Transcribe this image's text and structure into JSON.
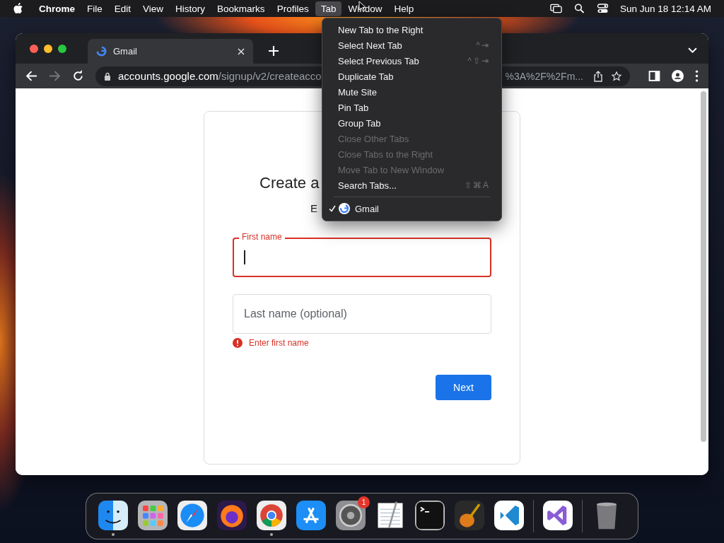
{
  "menu_bar": {
    "items": [
      {
        "label": "Chrome",
        "selected": false
      },
      {
        "label": "File",
        "selected": false
      },
      {
        "label": "Edit",
        "selected": false
      },
      {
        "label": "View",
        "selected": false
      },
      {
        "label": "History",
        "selected": false
      },
      {
        "label": "Bookmarks",
        "selected": false
      },
      {
        "label": "Profiles",
        "selected": false
      },
      {
        "label": "Tab",
        "selected": true
      },
      {
        "label": "Window",
        "selected": false
      },
      {
        "label": "Help",
        "selected": false
      }
    ],
    "clock": "Sun Jun 18  12:14 AM"
  },
  "browser": {
    "tabs": [
      {
        "title": "Gmail",
        "selected": true
      }
    ],
    "address": {
      "host": "accounts.google.com",
      "path": "/signup/v2/createacco",
      "tail": "%3A%2F%2Fm..."
    }
  },
  "page": {
    "title": "Create a",
    "subtitle": "E",
    "fields": [
      {
        "label": "First name",
        "focused": true,
        "error": true
      },
      {
        "placeholder": "Last name (optional)",
        "focused": false,
        "error": false
      }
    ],
    "error_message": "Enter first name",
    "next_button": "Next"
  },
  "tab_menu": {
    "items": [
      {
        "label": "New Tab to the Right",
        "disabled": false
      },
      {
        "label": "Select Next Tab",
        "shortcut": "^⇥",
        "disabled": false
      },
      {
        "label": "Select Previous Tab",
        "shortcut": "^⇧⇥",
        "disabled": false
      },
      {
        "label": "Duplicate Tab",
        "disabled": false
      },
      {
        "label": "Mute Site",
        "disabled": false
      },
      {
        "label": "Pin Tab",
        "disabled": false
      },
      {
        "label": "Group Tab",
        "disabled": false
      },
      {
        "label": "Close Other Tabs",
        "disabled": true
      },
      {
        "label": "Close Tabs to the Right",
        "disabled": true
      },
      {
        "label": "Move Tab to New Window",
        "disabled": true
      },
      {
        "label": "Search Tabs...",
        "shortcut": "⇧⌘A",
        "disabled": false
      }
    ],
    "open_tabs": [
      {
        "label": "Gmail",
        "checked": true
      }
    ]
  },
  "dock": {
    "items": [
      {
        "kind": "finder",
        "running": true
      },
      {
        "kind": "launchpad"
      },
      {
        "kind": "safari"
      },
      {
        "kind": "firefox"
      },
      {
        "kind": "chrome",
        "running": true
      },
      {
        "kind": "appstore"
      },
      {
        "kind": "settings",
        "badge": "1"
      },
      {
        "kind": "textedit"
      },
      {
        "kind": "terminal"
      },
      {
        "kind": "garageband"
      },
      {
        "kind": "vscode"
      },
      {
        "kind": "divider"
      },
      {
        "kind": "visualstudio"
      },
      {
        "kind": "divider"
      },
      {
        "kind": "trash"
      }
    ]
  }
}
